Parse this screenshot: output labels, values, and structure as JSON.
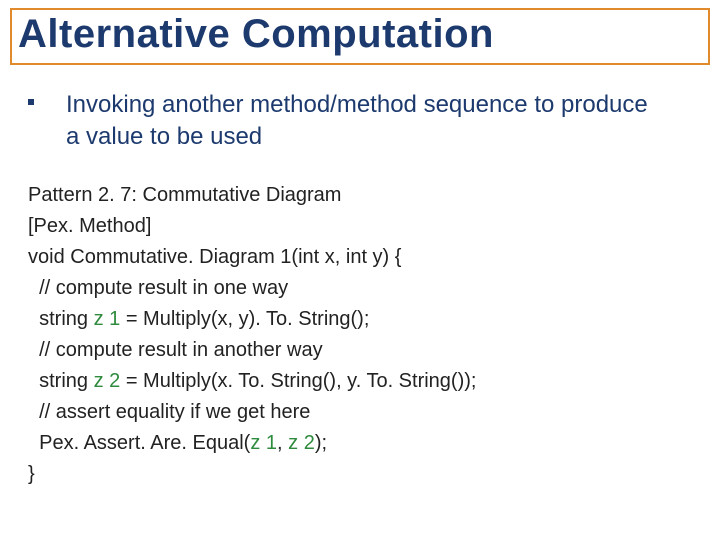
{
  "title": "Alternative Computation",
  "bullet": "Invoking another method/method sequence to produce a value to be used",
  "code": {
    "l1": "Pattern 2. 7: Commutative Diagram",
    "l2": "[Pex. Method]",
    "l3": "void Commutative. Diagram 1(int x, int y) {",
    "l4": "  // compute result in one way",
    "l5_a": "  string ",
    "l5_z": "z 1",
    "l5_b": " = Multiply(x, y). To. String();",
    "l6": "  // compute result in another way",
    "l7_a": "  string ",
    "l7_z": "z 2",
    "l7_b": " = Multiply(x. To. String(), y. To. String());",
    "l8": "  // assert equality if we get here",
    "l9_a": "  Pex. Assert. Are. Equal(",
    "l9_z1": "z 1",
    "l9_m": ", ",
    "l9_z2": "z 2",
    "l9_b": ");",
    "l10": "}"
  }
}
